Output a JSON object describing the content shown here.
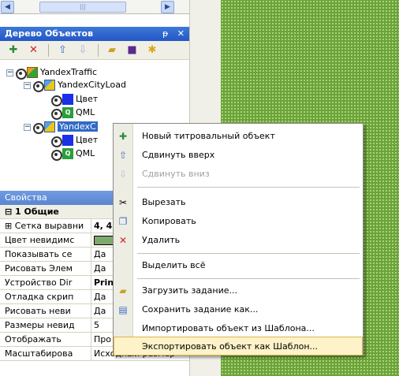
{
  "scrollbar": {
    "thumb_label": "|||"
  },
  "panel": {
    "title": "Дерево Объектов",
    "pin": "ᵽ",
    "close": "✕"
  },
  "toolbar": {
    "buttons": [
      "add-titled-object",
      "delete",
      "move-up",
      "move-down",
      "load-task",
      "save",
      "new-object"
    ]
  },
  "tree": {
    "nodes": [
      {
        "label": "YandexTraffic",
        "icon": "traffic-icon"
      },
      {
        "label": "YandexCityLoad",
        "icon": "city-icon"
      },
      {
        "label": "Цвет",
        "icon": "blue-square-icon"
      },
      {
        "label": "QML",
        "icon": "qml-icon"
      },
      {
        "label": "YandexC",
        "icon": "city-icon"
      },
      {
        "label": "Цвет",
        "icon": "blue-square-icon"
      },
      {
        "label": "QML",
        "icon": "qml-icon"
      }
    ]
  },
  "properties": {
    "title": "Свойства",
    "category": "1 Общие",
    "rows": [
      {
        "key": "Сетка выравни",
        "value": "4, 4"
      },
      {
        "key": "Цвет невидимс",
        "value": ""
      },
      {
        "key": "Показывать се",
        "value": "Да"
      },
      {
        "key": "Рисовать Элем",
        "value": "Да"
      },
      {
        "key": "Устройство Dir",
        "value": "Prin"
      },
      {
        "key": "Отладка скрип",
        "value": "Да"
      },
      {
        "key": "Рисовать неви",
        "value": "Да"
      },
      {
        "key": "Размеры невид",
        "value": "5"
      },
      {
        "key": "Отображать",
        "value": "Про"
      },
      {
        "key": "Масштабирова",
        "value": "Исходный размер"
      }
    ],
    "swatch_color": "#7fa86e"
  },
  "context_menu": {
    "items": [
      {
        "label": "Новый титровальный объект",
        "icon": "titled-object-icon",
        "disabled": false
      },
      {
        "label": "Сдвинуть вверх",
        "icon": "move-up-icon",
        "disabled": false
      },
      {
        "label": "Сдвинуть вниз",
        "icon": "move-down-icon",
        "disabled": true
      },
      {
        "label": "Вырезать",
        "icon": "scissors-icon",
        "disabled": false
      },
      {
        "label": "Копировать",
        "icon": "copy-icon",
        "disabled": false
      },
      {
        "label": "Удалить",
        "icon": "delete-icon",
        "disabled": false
      },
      {
        "label": "Выделить всё",
        "icon": "",
        "disabled": false
      },
      {
        "label": "Загрузить задание...",
        "icon": "open-folder-icon",
        "disabled": false
      },
      {
        "label": "Сохранить задание как...",
        "icon": "save-as-icon",
        "disabled": false
      },
      {
        "label": "Импортировать объект из Шаблона...",
        "icon": "",
        "disabled": false
      },
      {
        "label": "Экспортировать объект как  Шаблон...",
        "icon": "",
        "disabled": false
      }
    ]
  },
  "colors": {
    "titlebar": "#2457c5",
    "selection": "#316ac5",
    "highlight": "#fdf2c8",
    "background_dots": "#6ba23b"
  }
}
